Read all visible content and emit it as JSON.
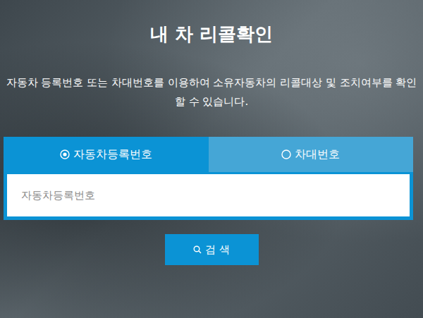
{
  "title": "내 차 리콜확인",
  "description": "자동차 등록번호 또는 차대번호를 이용하여 소유자동차의 리콜대상 및 조치여부를 확인할 수 있습니다.",
  "tabs": [
    {
      "label": "자동차등록번호",
      "selected": true
    },
    {
      "label": "차대번호",
      "selected": false
    }
  ],
  "search": {
    "placeholder": "자동차등록번호",
    "button": "검 색"
  }
}
